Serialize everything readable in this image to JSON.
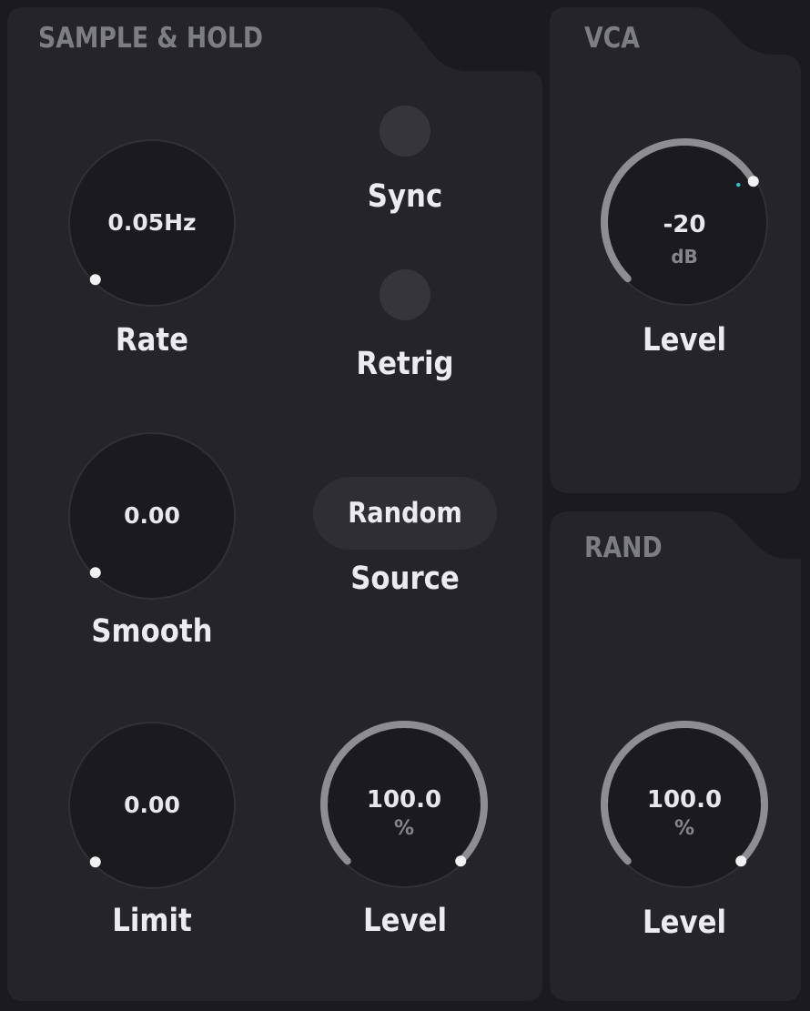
{
  "panels": {
    "sample_hold": {
      "title": "SAMPLE & HOLD"
    },
    "vca": {
      "title": "VCA"
    },
    "rand": {
      "title": "RAND"
    }
  },
  "controls": {
    "rate": {
      "label": "Rate",
      "value": "0.05Hz",
      "position": 0.0
    },
    "smooth": {
      "label": "Smooth",
      "value": "0.00",
      "position": 0.0
    },
    "limit": {
      "label": "Limit",
      "value": "0.00",
      "position": 0.0
    },
    "sync": {
      "label": "Sync",
      "active": false
    },
    "retrig": {
      "label": "Retrig",
      "active": false
    },
    "source": {
      "label": "Source",
      "value": "Random"
    },
    "sh_level": {
      "label": "Level",
      "value": "100.0",
      "unit": "%",
      "position": 1.0
    },
    "vca_level": {
      "label": "Level",
      "value": "-20",
      "unit": "dB",
      "position": 0.72
    },
    "rand_level": {
      "label": "Level",
      "value": "100.0",
      "unit": "%",
      "position": 1.0
    }
  },
  "colors": {
    "background": "#1b1b1f",
    "panel": "#24242a",
    "knob_body": "#1b1b1f",
    "knob_ring": "#303036",
    "value_arc": "#8d8d93",
    "indicator": "#f2f2f4",
    "accent": "#2ec4c4"
  }
}
